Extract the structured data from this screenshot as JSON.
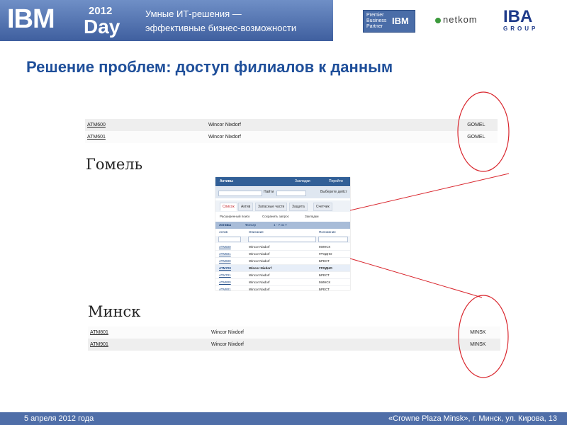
{
  "header": {
    "logo_ibm": "IBM",
    "logo_year": "2012",
    "logo_day": "Day",
    "tagline_line1": "Умные ИТ-решения —",
    "tagline_line2": "эффективные бизнес-возможности",
    "partner_text": "Premier\nBusiness\nPartner",
    "partner_ibm": "IBM",
    "netkom": "netkom",
    "iba": "IBA",
    "iba_group": "GROUP",
    "brand_color": "#3f5f9f"
  },
  "title": "Решение проблем:  доступ филиалов к данным",
  "gomel": {
    "label": "Гомель",
    "rows": [
      {
        "asset": "ATM600",
        "vendor": "Wincor Nixdorf",
        "location": "GOMEL"
      },
      {
        "asset": "ATM601",
        "vendor": "Wincor Nixdorf",
        "location": "GOMEL"
      }
    ]
  },
  "minsk": {
    "label": "Минск",
    "rows": [
      {
        "asset": "ATM801",
        "vendor": "Wincor Nixdorf",
        "location": "MINSK"
      },
      {
        "asset": "ATM901",
        "vendor": "Wincor Nixdorf",
        "location": "MINSK"
      }
    ]
  },
  "app": {
    "module_title": "Активы",
    "top_links": [
      "Закладки",
      "Перейти"
    ],
    "search_button": "Найти",
    "select_action": "Выберите дейст",
    "tabs": [
      "Список",
      "Актив",
      "Запасные части",
      "Защита",
      "Счетчик"
    ],
    "toolbar": {
      "advanced_search": "Расширенный поиск",
      "save_query": "Сохранить запрос",
      "bookmarks": "Закладки"
    },
    "grid_title": "Активы",
    "grid_filter": "Фильтр",
    "grid_paging": "1 - 7 из 7",
    "columns": [
      "Актив",
      "Описание",
      "Положение"
    ],
    "rows": [
      {
        "asset": "ATM500",
        "desc": "Wincor Nixdorf",
        "loc": "МИНСК"
      },
      {
        "asset": "ATM501",
        "desc": "Wincor Nixdorf",
        "loc": "ГРОДНО"
      },
      {
        "asset": "ATM600",
        "desc": "Wincor Nixdorf",
        "loc": "БРЕСТ"
      },
      {
        "asset": "ATM700",
        "desc": "Wincor Nixdorf",
        "loc": "ГРОДНО"
      },
      {
        "asset": "ATM701",
        "desc": "Wincor Nixdorf",
        "loc": "БРЕСТ"
      },
      {
        "asset": "ATM800",
        "desc": "Wincor Nixdorf",
        "loc": "МИНСК"
      },
      {
        "asset": "ATM801",
        "desc": "Wincor Nixdorf",
        "loc": "БРЕСТ"
      }
    ],
    "highlight_row": 3
  },
  "footer": {
    "date": "5 апреля 2012 года",
    "venue": "«Crowne Plaza Minsk», г. Минск, ул. Кирова, 13"
  },
  "colors": {
    "title": "#1f4f9a",
    "annotation": "#d9272e",
    "footer": "#4f6ea8"
  }
}
